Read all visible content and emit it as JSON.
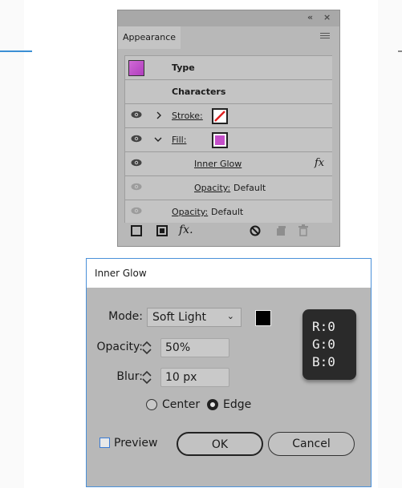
{
  "appearance_panel": {
    "tab_label": "Appearance",
    "collapse_glyph": "«",
    "close_glyph": "×",
    "rows": {
      "type_label": "Type",
      "characters_label": "Characters",
      "stroke_label": "Stroke:",
      "fill_label": "Fill:",
      "inner_glow_label": "Inner Glow",
      "fx_glyph": "fx",
      "fill_opacity_label": "Opacity:",
      "fill_opacity_value": "Default",
      "opacity_label": "Opacity:",
      "opacity_value": "Default"
    },
    "footer_fx": "fx."
  },
  "dialog": {
    "title": "Inner Glow",
    "mode_label": "Mode:",
    "mode_value": "Soft Light",
    "opacity_label": "Opacity:",
    "opacity_value": "50%",
    "blur_label": "Blur:",
    "blur_value": "10 px",
    "center_label": "Center",
    "edge_label": "Edge",
    "selected_option": "Edge",
    "preview_label": "Preview",
    "ok_label": "OK",
    "cancel_label": "Cancel"
  },
  "rgb_badge": {
    "r": "R:0",
    "g": "G:0",
    "b": "B:0"
  },
  "colors": {
    "fill_swatch": "#c44fc9",
    "glow_color": "#000000",
    "dialog_border": "#4a90d9"
  }
}
